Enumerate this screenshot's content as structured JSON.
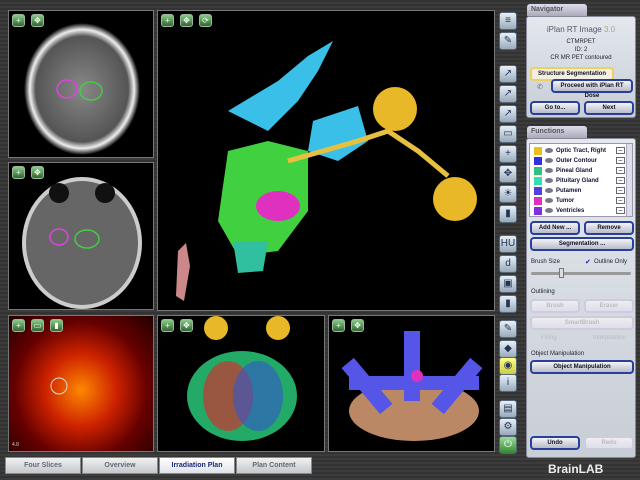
{
  "views": {
    "top_left": "axial CT",
    "mid_left": "axial MR",
    "bottom_left": "PET",
    "main": "3D structures",
    "bottom_mid": "fiber tracts",
    "bottom_right": "beam view"
  },
  "navigator": {
    "title": "Navigator",
    "app": "iPlan RT Image",
    "version": "3.0",
    "line1": "CTMRPET",
    "line2": "ID: 2",
    "line3": "CR MR PET contoured",
    "step": "Structure Segmentation",
    "proceed": "Proceed with iPlan RT Dose",
    "goto": "Go to...",
    "next": "Next"
  },
  "functions": {
    "title": "Functions",
    "structures": [
      {
        "name": "Optic Tract, Right",
        "color": "#e8c020"
      },
      {
        "name": "Outer Contour",
        "color": "#3030e0"
      },
      {
        "name": "Pineal Gland",
        "color": "#30c080"
      },
      {
        "name": "Pituitary Gland",
        "color": "#30e0b0"
      },
      {
        "name": "Putamen",
        "color": "#5040e0"
      },
      {
        "name": "Tumor",
        "color": "#e030c0"
      },
      {
        "name": "Ventricles",
        "color": "#8030e0"
      }
    ],
    "add_new": "Add New ...",
    "remove": "Remove",
    "segmentation": "Segmentation ...",
    "brush_size": "Brush Size",
    "outline_only": "Outline Only",
    "outlining": "Outlining",
    "brush": "Brush",
    "eraser": "Eraser",
    "smartbrush": "SmartBrush",
    "filling": "Filling",
    "interpolation": "Interpolation",
    "object_manipulation_label": "Object Manipulation",
    "object_manipulation": "Object Manipulation",
    "undo": "Undo",
    "redo": "Redo"
  },
  "tabs": [
    {
      "label": "Four Slices"
    },
    {
      "label": "Overview"
    },
    {
      "label": "Irradiation Plan"
    },
    {
      "label": "Plan Content"
    }
  ],
  "brand": "BrainLAB",
  "pet_label": "4.8"
}
